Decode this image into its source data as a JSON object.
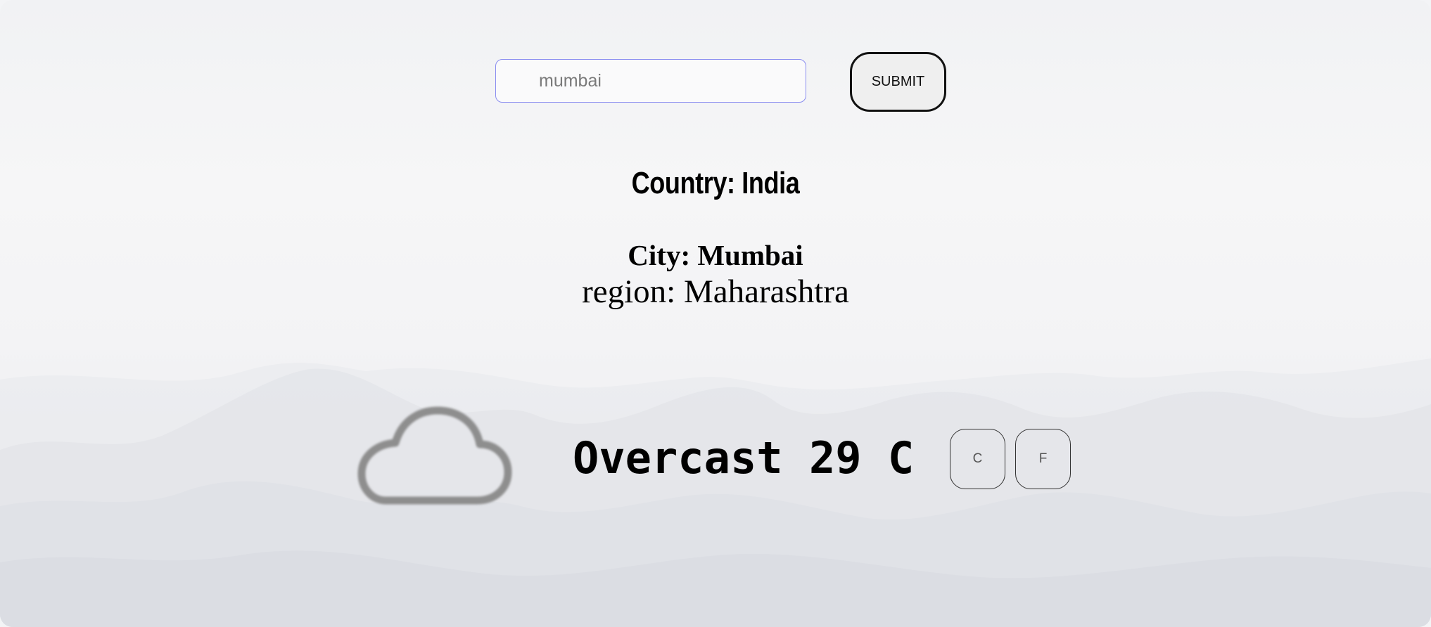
{
  "search": {
    "placeholder": "mumbai",
    "value": ""
  },
  "submit_label": "SUBMIT",
  "location": {
    "country": "Country: India",
    "city": "City: Mumbai",
    "region": "region: Maharashtra"
  },
  "weather": {
    "icon": "cloud-icon",
    "summary": "Overcast 29 C"
  },
  "unit_buttons": {
    "celsius": "C",
    "fahrenheit": "F"
  },
  "colors": {
    "input_border": "#8a8df0",
    "icon_gray": "#8e8e8e"
  }
}
